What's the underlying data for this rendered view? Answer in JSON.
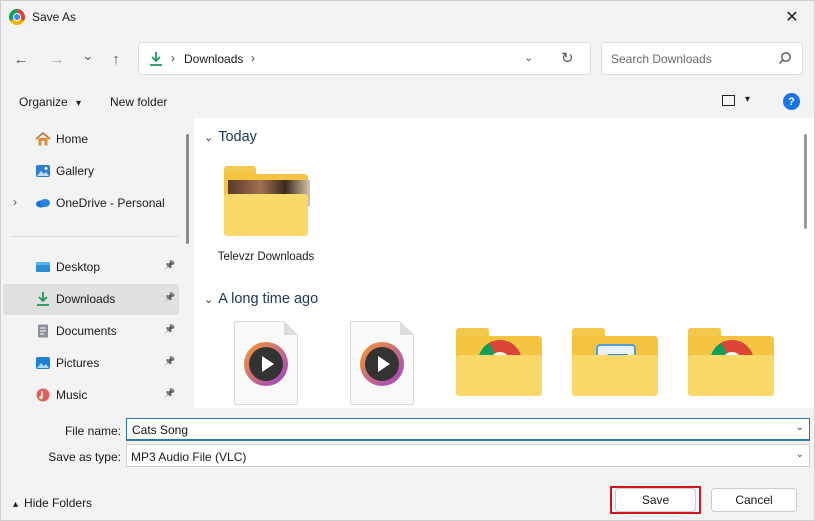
{
  "window": {
    "title": "Save As",
    "close_glyph": "✕"
  },
  "toolbar": {
    "back_glyph": "←",
    "forward_glyph": "→",
    "recent_glyph": "⌄",
    "up_glyph": "↑",
    "crumb_sep": "›",
    "breadcrumb": "Downloads",
    "search_placeholder": "Search Downloads"
  },
  "commands": {
    "organize": "Organize",
    "organize_caret": "▾",
    "new_folder": "New folder",
    "help": "?"
  },
  "sidebar": {
    "items": [
      {
        "label": "Home",
        "icon": "home-icon"
      },
      {
        "label": "Gallery",
        "icon": "gallery-icon"
      },
      {
        "label": "OneDrive - Personal",
        "icon": "onedrive-icon",
        "expander": "›"
      },
      {
        "label": "Desktop",
        "icon": "desktop-icon",
        "pin": "📌"
      },
      {
        "label": "Downloads",
        "icon": "download-icon",
        "pin": "📌",
        "selected": true
      },
      {
        "label": "Documents",
        "icon": "documents-icon",
        "pin": "📌"
      },
      {
        "label": "Pictures",
        "icon": "pictures-icon",
        "pin": "📌"
      },
      {
        "label": "Music",
        "icon": "music-icon",
        "pin": "📌"
      }
    ]
  },
  "content": {
    "groups": [
      {
        "title": "Today",
        "chev": "⌄"
      },
      {
        "title": "A long time ago",
        "chev": "⌄"
      }
    ],
    "today_items": [
      {
        "label": "Televzr Downloads",
        "type": "folder-with-thumbnail"
      }
    ],
    "old_items": [
      {
        "type": "media-file",
        "icon": "media-play-icon"
      },
      {
        "type": "media-file",
        "icon": "media-play-icon"
      },
      {
        "type": "folder",
        "icon": "chrome-icon"
      },
      {
        "type": "folder",
        "icon": "app-icon"
      },
      {
        "type": "folder",
        "icon": "chrome-icon"
      }
    ]
  },
  "form": {
    "file_name_label": "File name:",
    "file_name_value": "Cats Song",
    "save_type_label": "Save as type:",
    "save_type_value": "MP3 Audio File (VLC)",
    "dropdown_glyph": "⌄"
  },
  "footer": {
    "hide_folders": "Hide Folders",
    "caret": "▴",
    "save": "Save",
    "cancel": "Cancel"
  },
  "colors": {
    "accent": "#1a73e8",
    "highlight": "#d0141b",
    "selected_nav": "#e0e0e0"
  }
}
